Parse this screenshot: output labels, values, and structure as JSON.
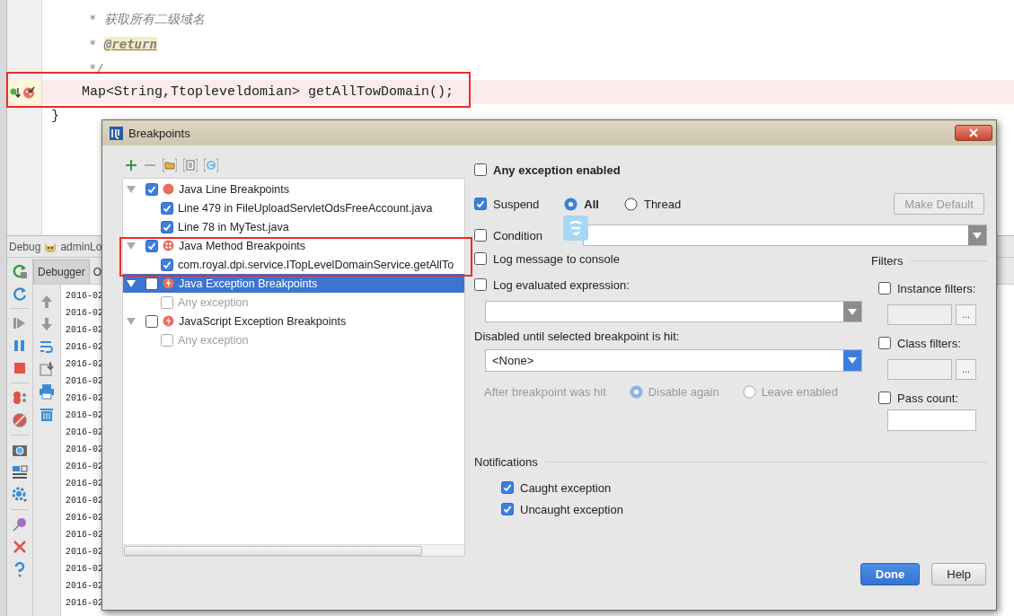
{
  "editor": {
    "lines": [
      {
        "kind": "comment",
        "text": "* 获取所有二级域名"
      },
      {
        "kind": "doc_tag",
        "prefix": "* ",
        "tag": "@return"
      },
      {
        "kind": "comment",
        "text": "*/"
      },
      {
        "kind": "member",
        "text": "Map<String,Ttopleveldomian> getAllTowDomain();",
        "highlighted": true,
        "breakpoint": true,
        "annotated": true
      },
      {
        "kind": "close",
        "text": "}"
      }
    ]
  },
  "debug": {
    "title": "Debug",
    "config": "adminLo",
    "tabs": [
      {
        "label": "Debugger",
        "selected": true
      },
      {
        "label": "O",
        "selected": false
      }
    ],
    "log": [
      "2016-02",
      "2016-02",
      "2016-02",
      "2016-02",
      "2016-02",
      "2016-02",
      "2016-02",
      "2016-02",
      "2016-02",
      "2016-02",
      "2016-02",
      "2016-02",
      "2016-02",
      "2016-02",
      "2016-02",
      "2016-02",
      "2016-02",
      "2016-02",
      "2016-02"
    ]
  },
  "dialog": {
    "title": "Breakpoints",
    "tree": [
      {
        "kind": "line",
        "label": "Java Line Breakpoints",
        "checked": true,
        "expanded": true,
        "selected": false,
        "annotated": false,
        "children": [
          {
            "label": "Line 479 in FileUploadServletOdsFreeAccount.java",
            "checked": true,
            "disabled": false
          },
          {
            "label": "Line 78 in MyTest.java",
            "checked": true,
            "disabled": false
          }
        ]
      },
      {
        "kind": "method",
        "label": "Java Method Breakpoints",
        "checked": true,
        "expanded": true,
        "selected": false,
        "annotated": true,
        "children": [
          {
            "label": "com.royal.dpi.service.ITopLevelDomainService.getAllTo",
            "checked": true,
            "disabled": false
          }
        ]
      },
      {
        "kind": "exception",
        "label": "Java Exception Breakpoints",
        "checked": false,
        "expanded": true,
        "selected": true,
        "annotated": false,
        "children": [
          {
            "label": "Any exception",
            "checked": false,
            "disabled": true
          }
        ]
      },
      {
        "kind": "exception",
        "label": "JavaScript Exception Breakpoints",
        "checked": false,
        "expanded": true,
        "selected": false,
        "annotated": false,
        "children": [
          {
            "label": "Any exception",
            "checked": false,
            "disabled": true
          }
        ]
      }
    ],
    "any_exception_enabled": {
      "label": "Any exception enabled",
      "checked": false
    },
    "suspend": {
      "label": "Suspend",
      "checked": true,
      "options": [
        {
          "label": "All",
          "selected": true
        },
        {
          "label": "Thread",
          "selected": false
        }
      ]
    },
    "make_default": {
      "label": "Make Default",
      "disabled": true
    },
    "condition": {
      "label": "Condition",
      "checked": false
    },
    "log_message": {
      "label": "Log message to console",
      "checked": false
    },
    "log_expression": {
      "label": "Log evaluated expression:",
      "checked": false
    },
    "disabled_until": {
      "label": "Disabled until selected breakpoint is hit:",
      "value": "<None>"
    },
    "after_hit": {
      "label": "After breakpoint was hit",
      "disabled": true,
      "options": [
        {
          "label": "Disable again",
          "selected": true
        },
        {
          "label": "Leave enabled",
          "selected": false
        }
      ]
    },
    "filters": {
      "title": "Filters",
      "items": [
        {
          "kind": "with_button",
          "label": "Instance filters:",
          "checked": false,
          "button": "..."
        },
        {
          "kind": "with_button",
          "label": "Class filters:",
          "checked": false,
          "button": "..."
        },
        {
          "kind": "plain",
          "label": "Pass count:",
          "checked": false
        }
      ]
    },
    "notifications": {
      "title": "Notifications",
      "items": [
        {
          "label": "Caught exception",
          "checked": true
        },
        {
          "label": "Uncaught exception",
          "checked": true
        }
      ]
    },
    "buttons": [
      {
        "kind": "primary",
        "label": "Done"
      },
      {
        "kind": "default",
        "label": "Help"
      }
    ]
  }
}
